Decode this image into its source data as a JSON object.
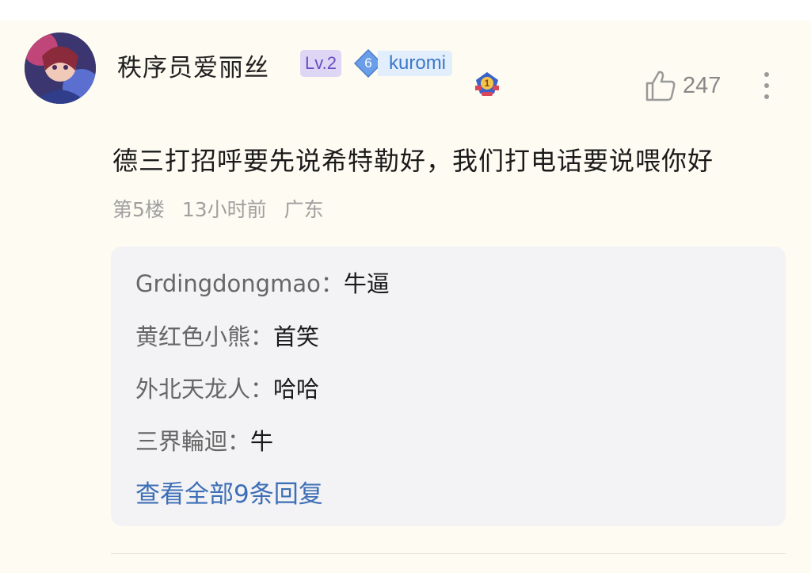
{
  "comment": {
    "username": "秩序员爱丽丝",
    "level_badge": "Lv.2",
    "fan_badge": {
      "level": "6",
      "name": "kuromi"
    },
    "rank_icon": "rank-1-medal-icon",
    "like_count": "247",
    "text": "德三打招呼要先说希特勒好，我们打电话要说喂你好",
    "meta": {
      "floor": "第5楼",
      "time": "13小时前",
      "location": "广东"
    },
    "replies": [
      {
        "name": "Grdingdongmao：",
        "text": "牛逼"
      },
      {
        "name": "黄红色小熊：",
        "text": "首笑"
      },
      {
        "name": "外北天龙人：",
        "text": "哈哈"
      },
      {
        "name": "三界輪迴：",
        "text": "牛"
      }
    ],
    "view_all": "查看全部9条回复"
  },
  "colors": {
    "background": "#fdfbf2",
    "reply_box": "#f3f3f5",
    "link": "#3d6fb6",
    "level_badge_bg": "#ded6f5",
    "fan_badge_bg": "#e3eefc"
  }
}
